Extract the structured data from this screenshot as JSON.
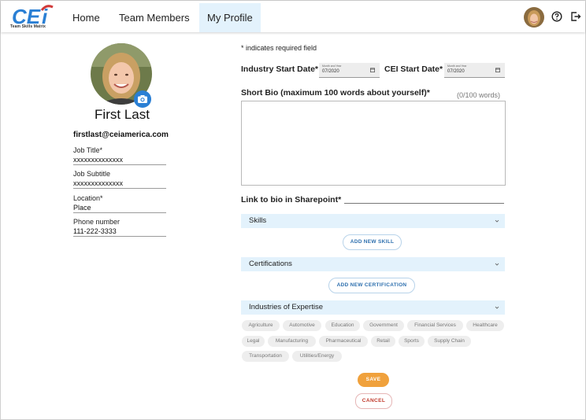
{
  "app": {
    "logo_text": "CEi",
    "logo_subtitle": "Team Skills Matrix",
    "brand_color": "#2a7fd4",
    "logo_red": "#d03a3a"
  },
  "nav": {
    "tabs": [
      {
        "label": "Home",
        "active": false
      },
      {
        "label": "Team Members",
        "active": false
      },
      {
        "label": "My Profile",
        "active": true
      }
    ],
    "icons": [
      "avatar",
      "help-icon",
      "logout-icon"
    ]
  },
  "profile": {
    "name": "First Last",
    "email": "firstlast@ceiamerica.com",
    "fields": [
      {
        "label": "Job Title*",
        "value": "xxxxxxxxxxxxxx"
      },
      {
        "label": "Job Subtitle",
        "value": "xxxxxxxxxxxxxx"
      },
      {
        "label": "Location*",
        "value": "Place"
      },
      {
        "label": "Phone number",
        "value": "111-222-3333"
      }
    ]
  },
  "form": {
    "required_note": "* indicates required field",
    "industry_start": {
      "label": "Industry Start Date*",
      "hint": "Month and Year",
      "value": "07/2020"
    },
    "cei_start": {
      "label": "CEI Start Date*",
      "hint": "Month and Year",
      "value": "07/2020"
    },
    "bio": {
      "label": "Short Bio (maximum 100 words about yourself)*",
      "word_count": "(0/100 words)",
      "value": ""
    },
    "sharepoint_label": "Link to bio in Sharepoint*",
    "skills": {
      "title": "Skills",
      "add_label": "ADD NEW SKILL"
    },
    "certifications": {
      "title": "Certifications",
      "add_label": "ADD NEW CERTIFICATION"
    },
    "industries": {
      "title": "Industries of Expertise",
      "chips": [
        "Agriculture",
        "Automotive",
        "Education",
        "Government",
        "Financial Services",
        "Healthcare",
        "Legal",
        "Manufacturing",
        "Pharmaceutical",
        "Retail",
        "Sports",
        "Supply Chain",
        "Transportation",
        "Utilities/Energy"
      ]
    },
    "save_label": "SAVE",
    "cancel_label": "CANCEL",
    "save_color": "#f0a13c",
    "section_bg": "#e3f2fc"
  }
}
